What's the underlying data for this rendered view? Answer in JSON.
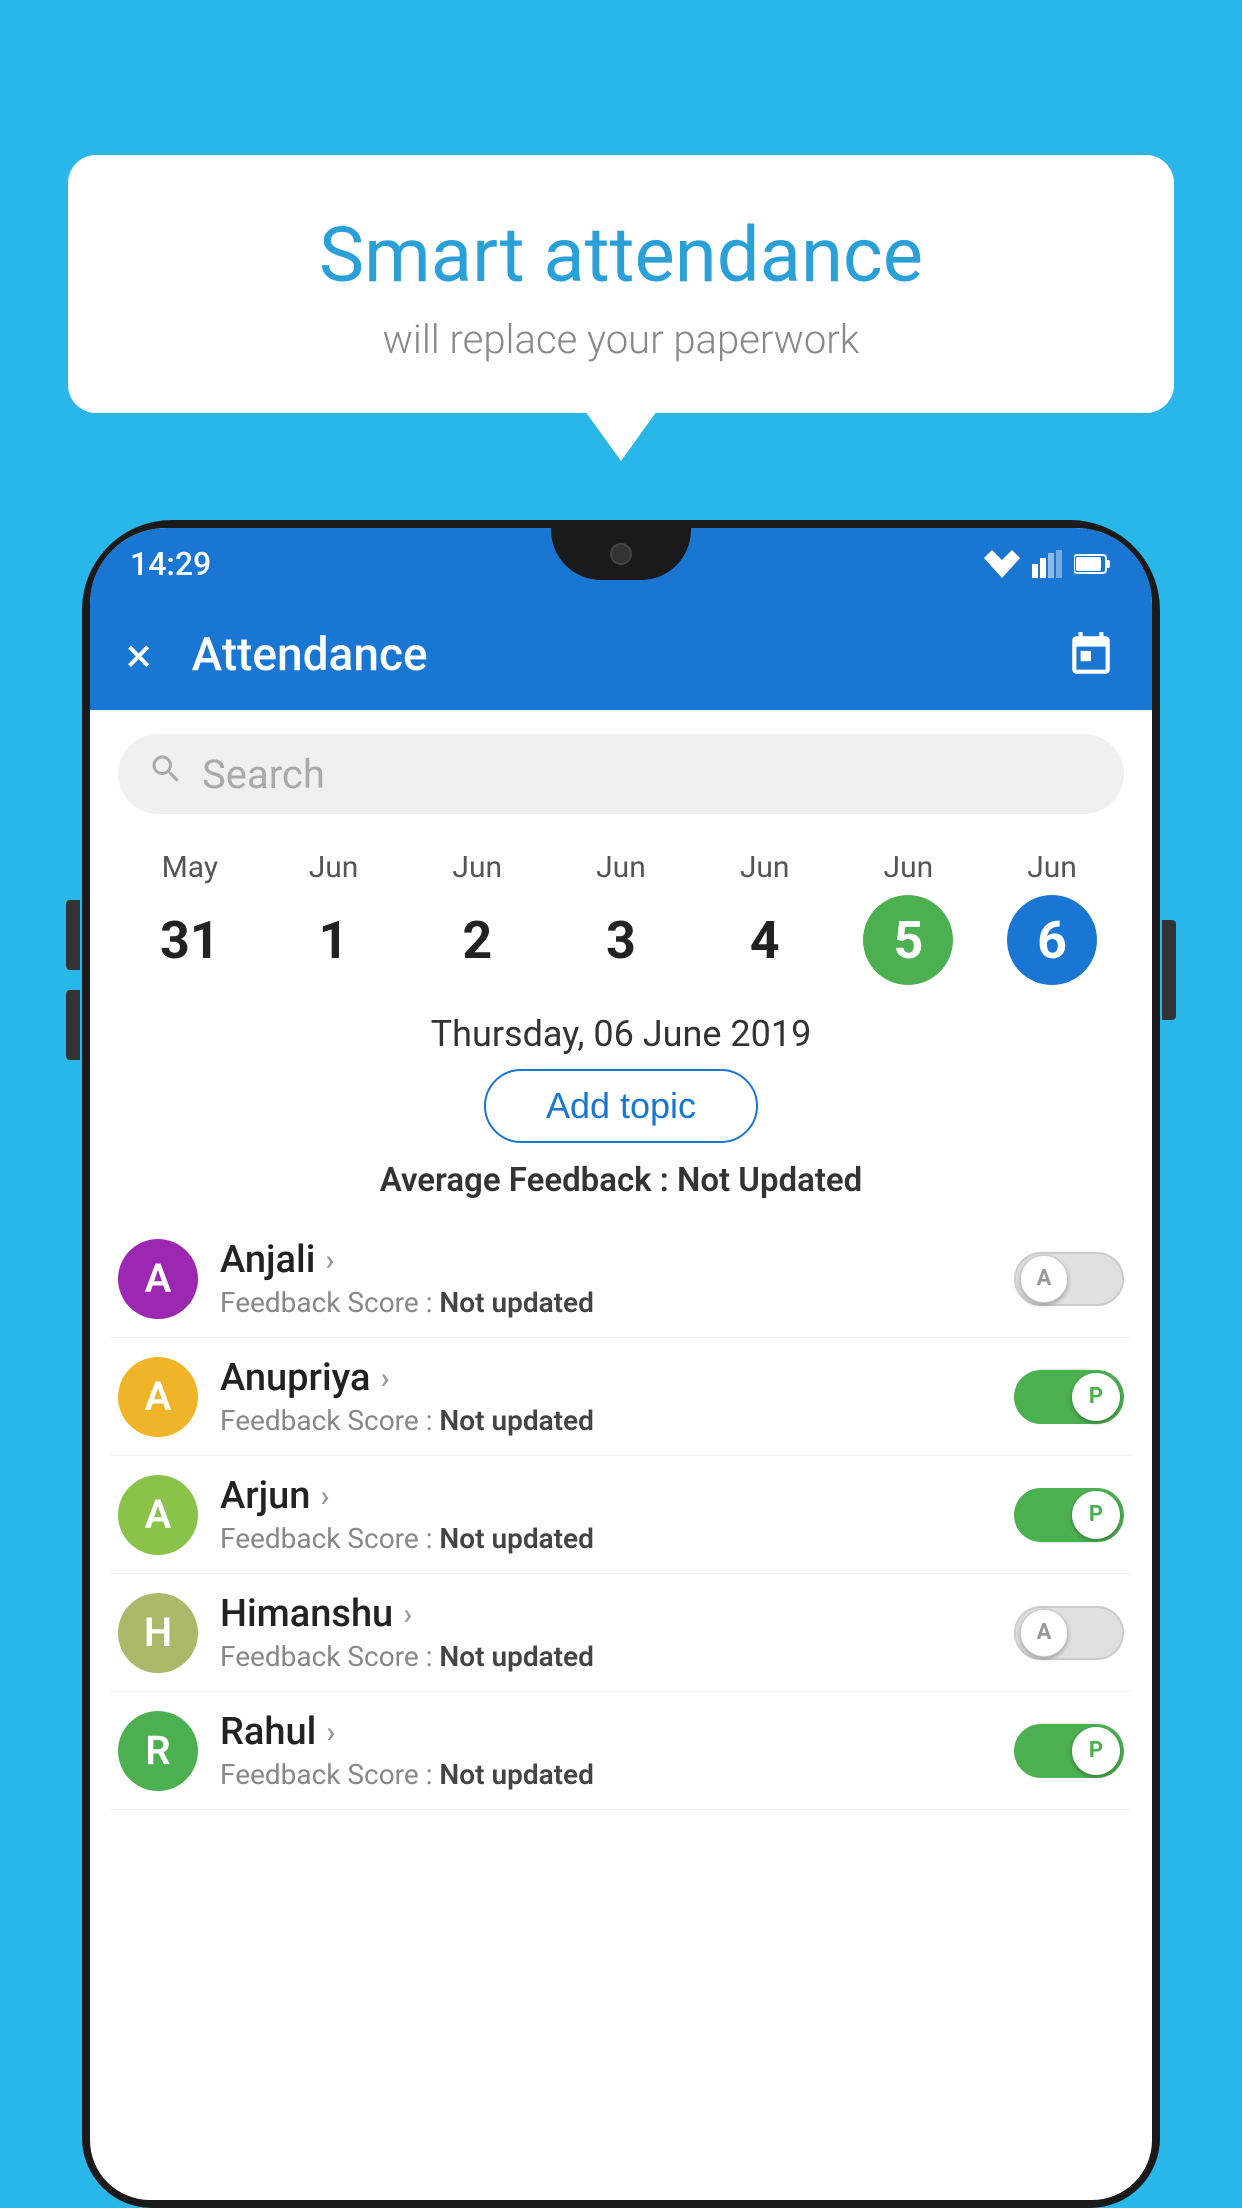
{
  "background_color": "#29b6e8",
  "speech_bubble": {
    "title": "Smart attendance",
    "subtitle": "will replace your paperwork"
  },
  "status_bar": {
    "time": "14:29"
  },
  "app_bar": {
    "title": "Attendance",
    "close_label": "×",
    "calendar_icon": "calendar-icon"
  },
  "search": {
    "placeholder": "Search"
  },
  "calendar": {
    "days": [
      {
        "month": "May",
        "date": "31",
        "style": "normal"
      },
      {
        "month": "Jun",
        "date": "1",
        "style": "normal"
      },
      {
        "month": "Jun",
        "date": "2",
        "style": "normal"
      },
      {
        "month": "Jun",
        "date": "3",
        "style": "normal"
      },
      {
        "month": "Jun",
        "date": "4",
        "style": "normal"
      },
      {
        "month": "Jun",
        "date": "5",
        "style": "green"
      },
      {
        "month": "Jun",
        "date": "6",
        "style": "blue"
      }
    ],
    "selected_date": "Thursday, 06 June 2019"
  },
  "add_topic_label": "Add topic",
  "average_feedback_label": "Average Feedback :",
  "average_feedback_value": "Not Updated",
  "students": [
    {
      "name": "Anjali",
      "avatar_letter": "A",
      "avatar_color": "#9c27b0",
      "feedback_label": "Feedback Score :",
      "feedback_value": "Not updated",
      "toggle": "off",
      "toggle_letter": "A"
    },
    {
      "name": "Anupriya",
      "avatar_letter": "A",
      "avatar_color": "#f0b429",
      "feedback_label": "Feedback Score :",
      "feedback_value": "Not updated",
      "toggle": "on",
      "toggle_letter": "P"
    },
    {
      "name": "Arjun",
      "avatar_letter": "A",
      "avatar_color": "#8bc34a",
      "feedback_label": "Feedback Score :",
      "feedback_value": "Not updated",
      "toggle": "on",
      "toggle_letter": "P"
    },
    {
      "name": "Himanshu",
      "avatar_letter": "H",
      "avatar_color": "#aab867",
      "feedback_label": "Feedback Score :",
      "feedback_value": "Not updated",
      "toggle": "off",
      "toggle_letter": "A"
    },
    {
      "name": "Rahul",
      "avatar_letter": "R",
      "avatar_color": "#4caf50",
      "feedback_label": "Feedback Score :",
      "feedback_value": "Not updated",
      "toggle": "on",
      "toggle_letter": "P"
    }
  ]
}
